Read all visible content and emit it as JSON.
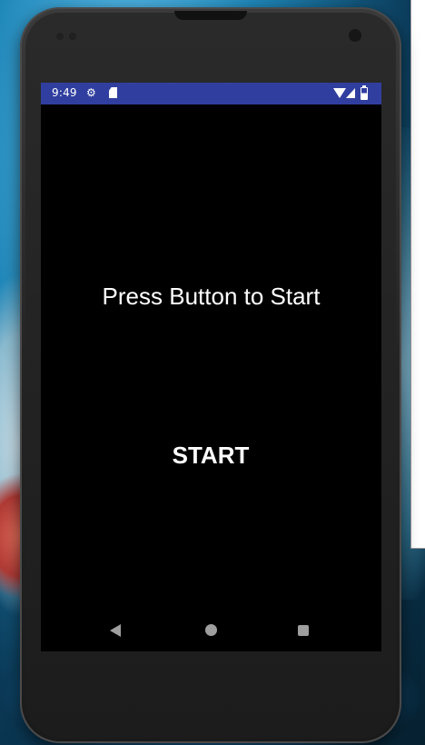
{
  "status_bar": {
    "time": "9:49",
    "background_color": "#303f9f",
    "icons": [
      "gear-icon",
      "sd-card-icon",
      "wifi-icon",
      "signal-icon",
      "battery-icon"
    ]
  },
  "screen": {
    "background_color": "#000000",
    "prompt": "Press Button to Start",
    "start_button_label": "START"
  },
  "nav_bar": {
    "icons": [
      "back-icon",
      "home-icon",
      "recents-icon"
    ]
  }
}
